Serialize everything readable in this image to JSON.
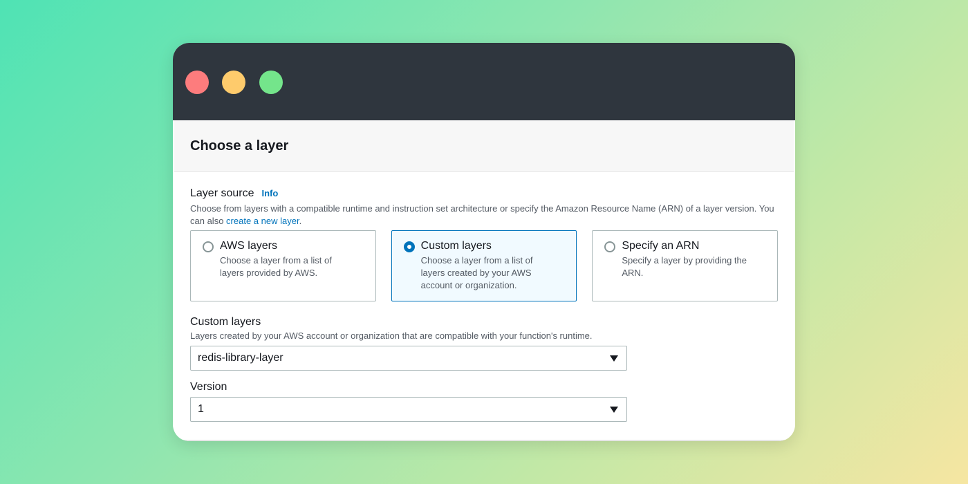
{
  "panel": {
    "title": "Choose a layer"
  },
  "layer_source": {
    "label": "Layer source",
    "info": "Info",
    "description": "Choose from layers with a compatible runtime and instruction set architecture or specify the Amazon Resource Name (ARN) of a layer version. You can also ",
    "link_text": "create a new layer",
    "period": ".",
    "options": [
      {
        "title": "AWS layers",
        "desc": "Choose a layer from a list of layers provided by AWS.",
        "selected": false
      },
      {
        "title": "Custom layers",
        "desc": "Choose a layer from a list of layers created by your AWS account or organization.",
        "selected": true
      },
      {
        "title": "Specify an ARN",
        "desc": "Specify a layer by providing the ARN.",
        "selected": false
      }
    ]
  },
  "custom_layers": {
    "label": "Custom layers",
    "description": "Layers created by your AWS account or organization that are compatible with your function's runtime.",
    "value": "redis-library-layer"
  },
  "version": {
    "label": "Version",
    "value": "1"
  },
  "colors": {
    "accent": "#0073bb",
    "titlebar": "#2f363e"
  }
}
